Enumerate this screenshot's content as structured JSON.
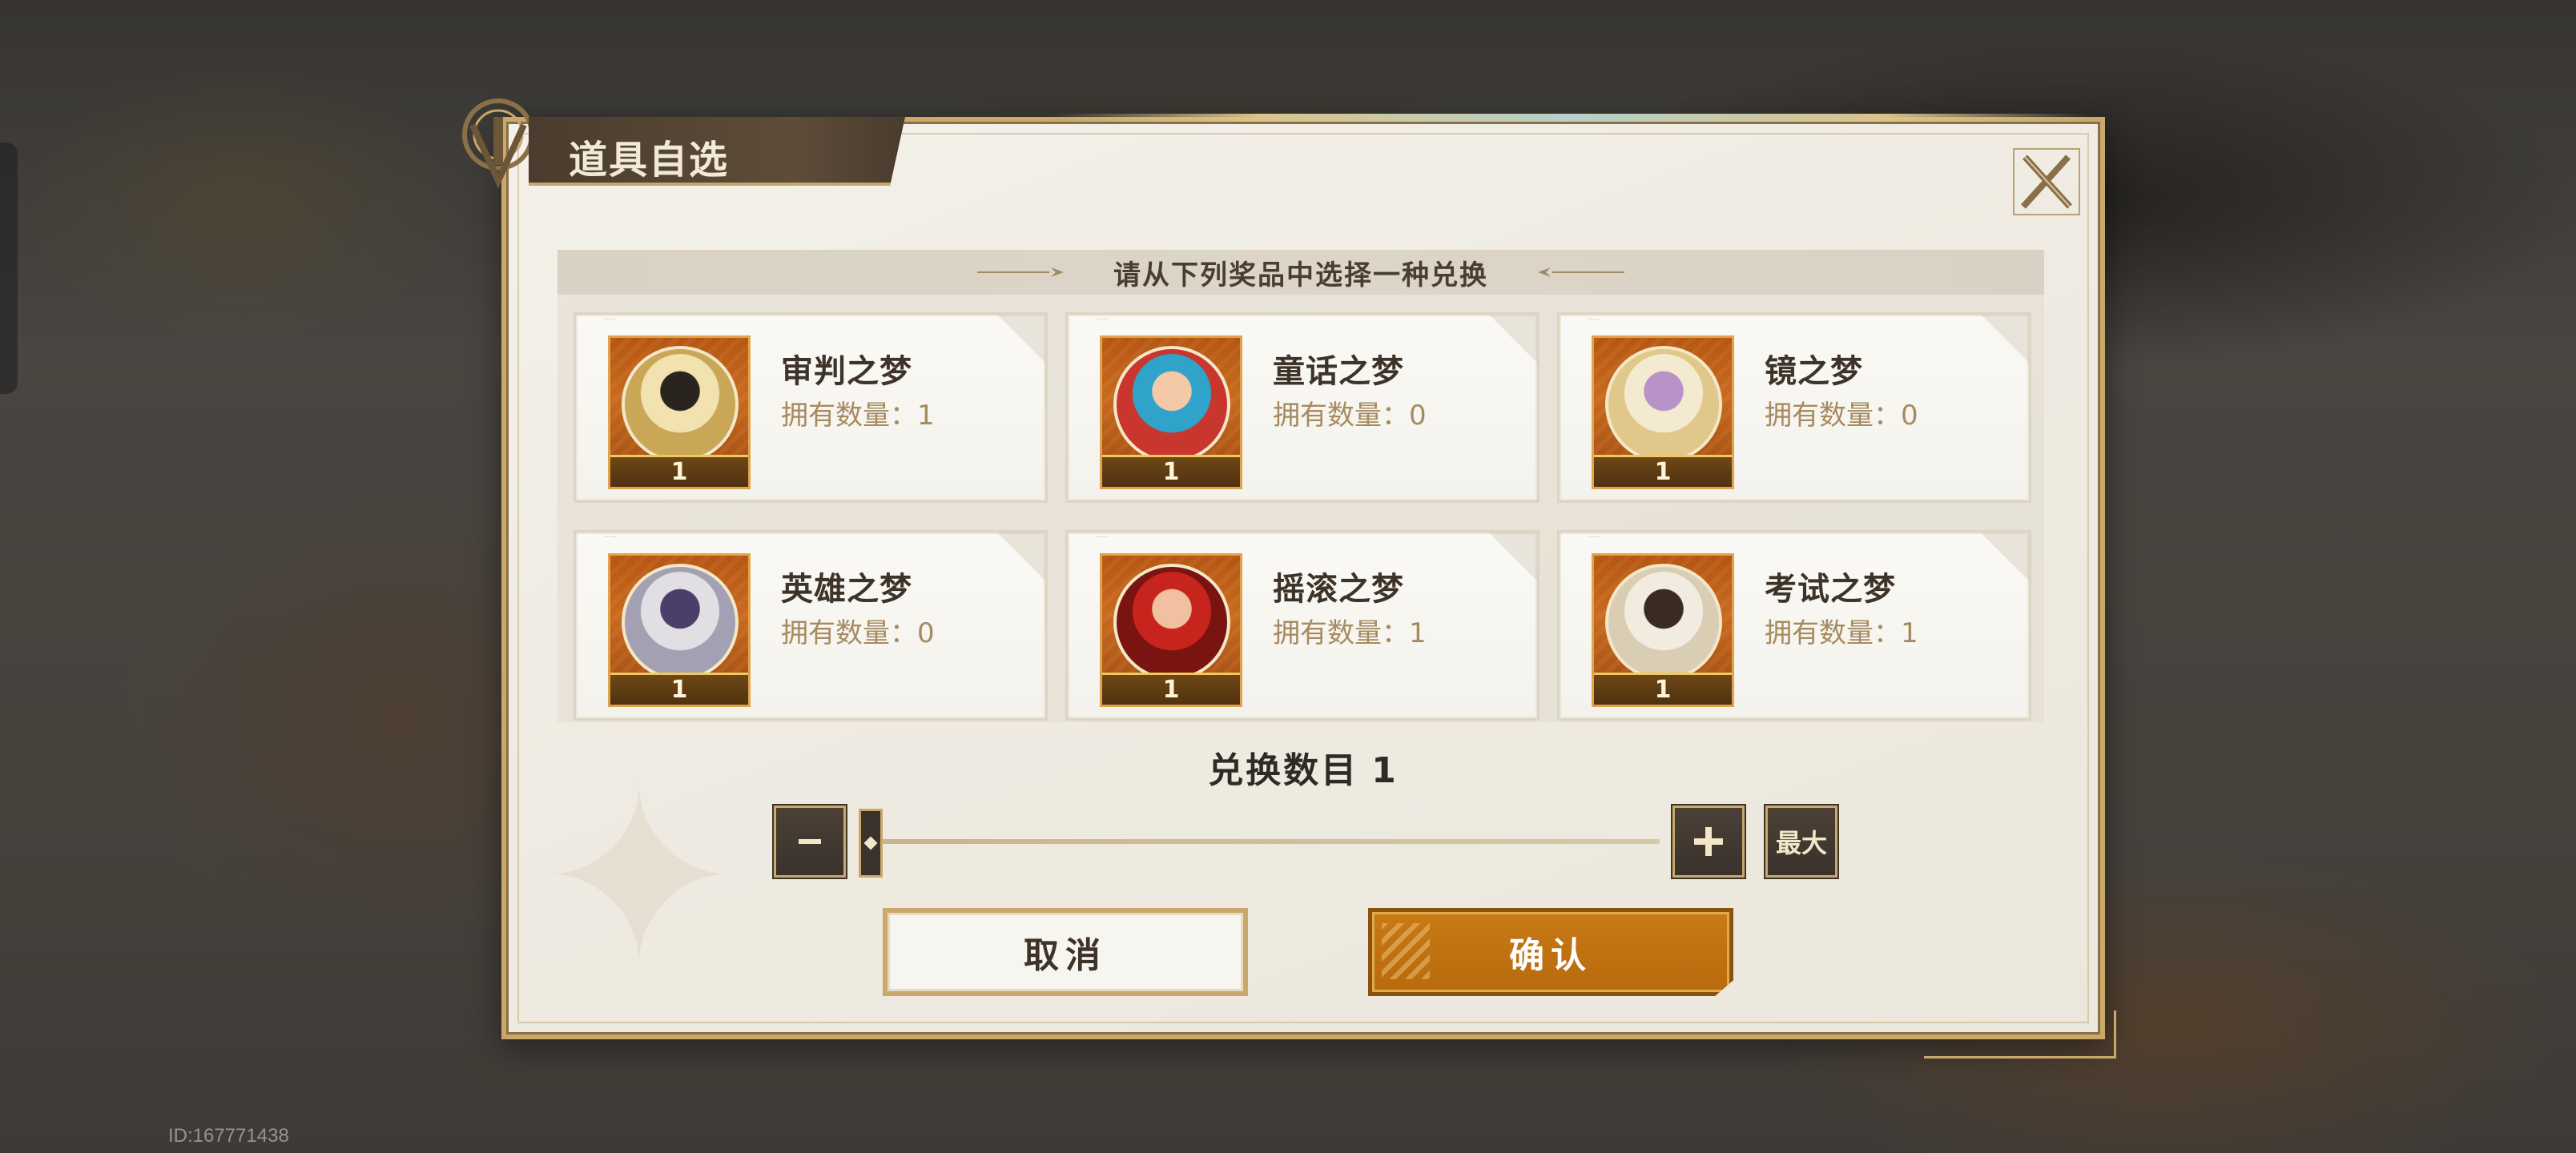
{
  "dialog": {
    "title": "道具自选",
    "header": "请从下列奖品中选择一种兑换",
    "close_icon": "close-x-icon"
  },
  "items": [
    {
      "name": "审判之梦",
      "own_label": "拥有数量：",
      "own_count": "1",
      "icon_count": "1",
      "portrait_colors": [
        "#f1e2b0",
        "#c9a757",
        "#2a241f"
      ]
    },
    {
      "name": "童话之梦",
      "own_label": "拥有数量：",
      "own_count": "0",
      "icon_count": "1",
      "portrait_colors": [
        "#2fa3c9",
        "#c8362e",
        "#f4c9a8"
      ]
    },
    {
      "name": "镜之梦",
      "own_label": "拥有数量：",
      "own_count": "0",
      "icon_count": "1",
      "portrait_colors": [
        "#f3ead0",
        "#e0c78a",
        "#b892c8"
      ]
    },
    {
      "name": "英雄之梦",
      "own_label": "拥有数量：",
      "own_count": "0",
      "icon_count": "1",
      "portrait_colors": [
        "#e2dfe4",
        "#a4a0b3",
        "#4a3e6a"
      ]
    },
    {
      "name": "摇滚之梦",
      "own_label": "拥有数量：",
      "own_count": "1",
      "icon_count": "1",
      "portrait_colors": [
        "#c8241e",
        "#7a1410",
        "#f0c0a0"
      ]
    },
    {
      "name": "考试之梦",
      "own_label": "拥有数量：",
      "own_count": "1",
      "icon_count": "1",
      "portrait_colors": [
        "#f2ece0",
        "#d9cdb3",
        "#3a2a22"
      ]
    }
  ],
  "quantity": {
    "label": "兑换数目",
    "value": "1",
    "slider_fraction": 0.0,
    "minus_icon": "minus-icon",
    "plus_icon": "plus-icon",
    "max_label": "最大"
  },
  "buttons": {
    "cancel": "取消",
    "confirm": "确认"
  },
  "footer": {
    "player_id": "ID:167771438"
  },
  "colors": {
    "accent_gold": "#c9a86a",
    "confirm_orange": "#c87a16",
    "dark_brown": "#3d3328"
  }
}
